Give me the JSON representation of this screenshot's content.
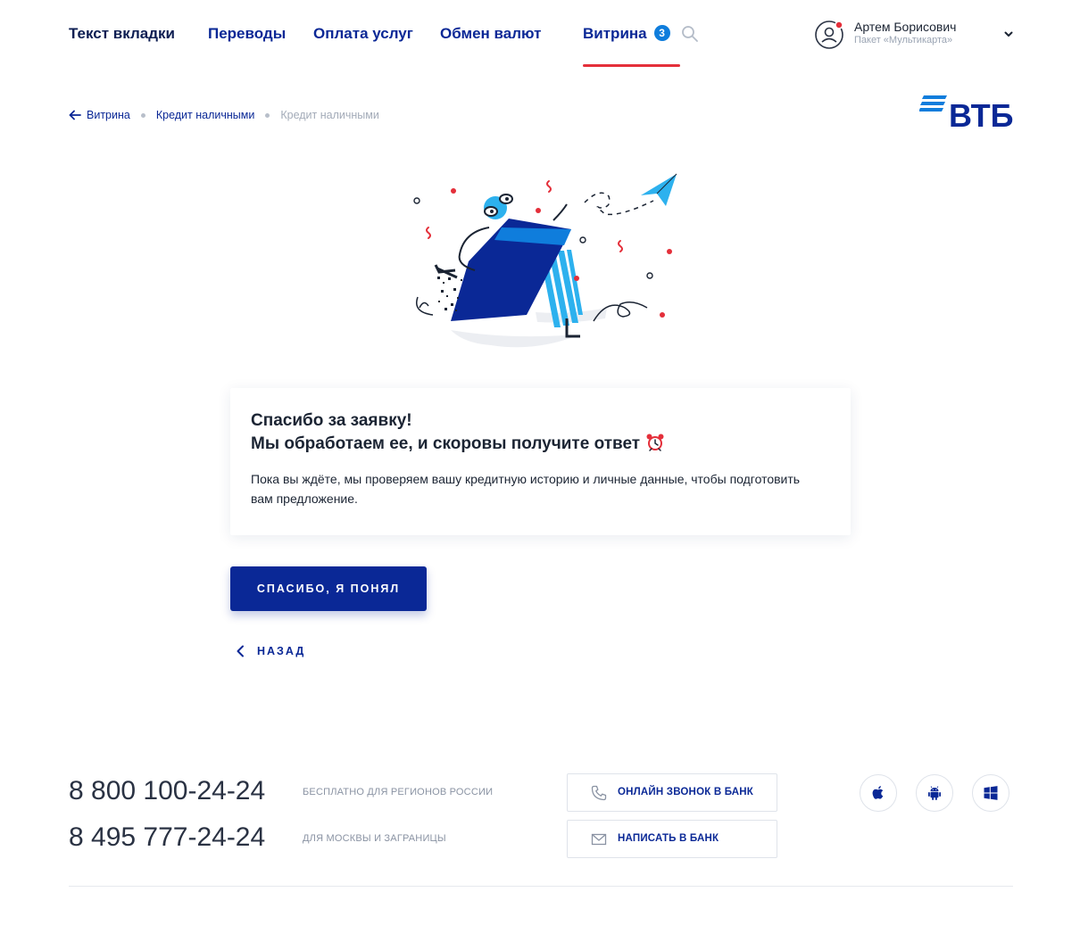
{
  "header": {
    "tabs": [
      {
        "label": "Текст вкладки"
      },
      {
        "label": "Переводы"
      },
      {
        "label": "Оплата услуг"
      },
      {
        "label": "Обмен валют"
      },
      {
        "label": "Витрина",
        "badge": "3",
        "active": true
      }
    ],
    "user": {
      "name": "Артем Борисович",
      "package": "Пакет «Мультикарта»"
    }
  },
  "breadcrumb": {
    "back_label": "Витрина",
    "items": [
      "Кредит наличными",
      "Кредит наличными"
    ]
  },
  "logo": {
    "text": "ВТБ"
  },
  "card": {
    "title_line1": "Спасибо за заявку!",
    "title_line2": "Мы обработаем ее, и скоровы получите ответ",
    "body": "Пока вы ждёте, мы проверяем вашу кредитную историю и личные данные, чтобы подготовить вам  предложение."
  },
  "actions": {
    "primary_label": "СПАСИБО, Я ПОНЯЛ",
    "back_label": "НАЗАД"
  },
  "footer": {
    "phones": [
      {
        "number": "8 800 100-24-24",
        "note": "БЕСПЛАТНО ДЛЯ РЕГИОНОВ РОССИИ"
      },
      {
        "number": "8 495 777-24-24",
        "note": "ДЛЯ МОСКВЫ И ЗАГРАНИЦЫ"
      }
    ],
    "call_label": "ОНЛАЙН ЗВОНОК В БАНК",
    "write_label": "НАПИСАТЬ В БАНК",
    "stores": [
      "apple-icon",
      "android-icon",
      "windows-icon"
    ]
  },
  "colors": {
    "brand_blue": "#0a2896",
    "accent_red": "#e42f3a",
    "badge_blue": "#0f7ddc",
    "text_dark": "#1b2433",
    "muted": "#a3abb8"
  }
}
